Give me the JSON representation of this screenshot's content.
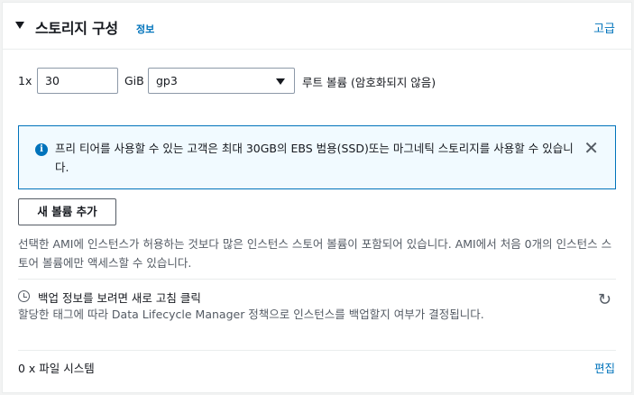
{
  "header": {
    "title": "스토리지 구성",
    "info_label": "정보",
    "advanced_label": "고급"
  },
  "volume": {
    "count_label": "1x",
    "size_value": "30",
    "size_unit": "GiB",
    "type_selected": "gp3",
    "root_label": "루트 볼륨  (암호화되지 않음)"
  },
  "alert": {
    "text": "프리 티어를 사용할 수 있는 고객은 최대 30GB의 EBS 범용(SSD)또는 마그네틱 스토리지를 사용할 수 있습니다."
  },
  "add_volume_label": "새 볼륨 추가",
  "note": "선택한 AMI에 인스턴스가 허용하는 것보다 많은 인스턴스 스토어 볼륨이 포함되어 있습니다. AMI에서 처음 0개의 인스턴스 스토어 볼륨에만 액세스할 수 있습니다.",
  "backup": {
    "title": "백업 정보를 보려면 새로 고침 클릭",
    "description": "할당한 태그에 따라 Data Lifecycle Manager 정책으로 인스턴스를 백업할지 여부가 결정됩니다."
  },
  "filesystems": {
    "label": "0 x 파일 시스템",
    "edit_label": "편집"
  },
  "icons": {
    "collapse": "caret-down-icon",
    "info": "info-icon",
    "close": "close-icon",
    "select": "chevron-down-icon",
    "clock": "clock-icon",
    "refresh": "refresh-icon"
  },
  "colors": {
    "link": "#0073bb",
    "alert_border": "#0073bb",
    "alert_bg": "#f1faff",
    "text": "#16191f",
    "muted": "#545b64"
  }
}
